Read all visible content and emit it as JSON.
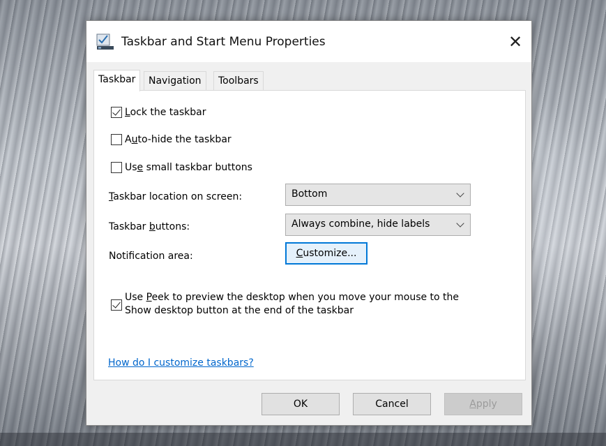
{
  "window": {
    "title": "Taskbar and Start Menu Properties",
    "close_glyph": "✕"
  },
  "tabs": [
    {
      "label": "Taskbar",
      "active": true
    },
    {
      "label": "Navigation",
      "active": false
    },
    {
      "label": "Toolbars",
      "active": false
    }
  ],
  "options": {
    "lock": {
      "checked": true,
      "pre": "",
      "key": "L",
      "post": "ock the taskbar"
    },
    "autohide": {
      "checked": false,
      "pre": "A",
      "key": "u",
      "post": "to-hide the taskbar"
    },
    "small": {
      "checked": false,
      "pre": "Us",
      "key": "e",
      "post": " small taskbar buttons"
    }
  },
  "location": {
    "label_key": "T",
    "label_rest": "askbar location on screen:",
    "value": "Bottom"
  },
  "buttons_setting": {
    "label_pre": "Taskbar ",
    "label_key": "b",
    "label_post": "uttons:",
    "value": "Always combine, hide labels"
  },
  "notification": {
    "label": "Notification area:",
    "button_key": "C",
    "button_rest": "ustomize..."
  },
  "peek": {
    "checked": true,
    "line1_pre": "Use ",
    "line1_key": "P",
    "line1_post": "eek to preview the desktop when you move your mouse to the",
    "line2": "Show desktop button at the end of the taskbar"
  },
  "help_link": "How do I customize taskbars?",
  "footer": {
    "ok": "OK",
    "cancel": "Cancel",
    "apply_key": "A",
    "apply_rest": "pply"
  },
  "colors": {
    "accent": "#0078d7",
    "link": "#0066cc"
  }
}
